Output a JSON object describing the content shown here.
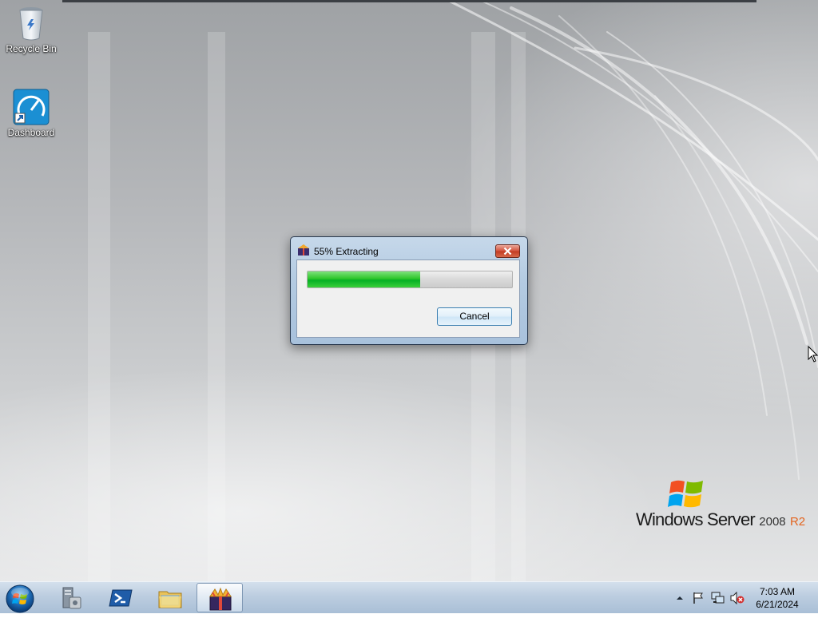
{
  "desktop": {
    "icons": [
      {
        "label": "Recycle Bin",
        "icon": "recycle-bin-icon"
      },
      {
        "label": "Dashboard",
        "icon": "dashboard-shortcut-icon"
      }
    ],
    "logo": {
      "brand": "Windows Server",
      "version": "2008",
      "edition": "R2"
    }
  },
  "dialog": {
    "title": "55% Extracting",
    "progress": 0.55,
    "cancel_label": "Cancel",
    "close_icon": "close-icon",
    "app_icon": "archive-app-icon"
  },
  "taskbar": {
    "start_icon": "start-orb-icon",
    "pinned": [
      {
        "name": "server-manager",
        "icon": "server-manager-icon"
      },
      {
        "name": "powershell",
        "icon": "powershell-icon"
      },
      {
        "name": "explorer",
        "icon": "folder-icon"
      },
      {
        "name": "extractor",
        "icon": "archive-app-icon",
        "active": true
      }
    ],
    "tray_icons": [
      "show-hidden-icons-icon",
      "action-center-flag-icon",
      "network-icon",
      "volume-muted-icon"
    ],
    "clock": {
      "time": "7:03 AM",
      "date": "6/21/2024"
    }
  },
  "colors": {
    "progress_green": "#06b025",
    "close_red": "#c23b22",
    "brand_orange": "#e3641f"
  }
}
